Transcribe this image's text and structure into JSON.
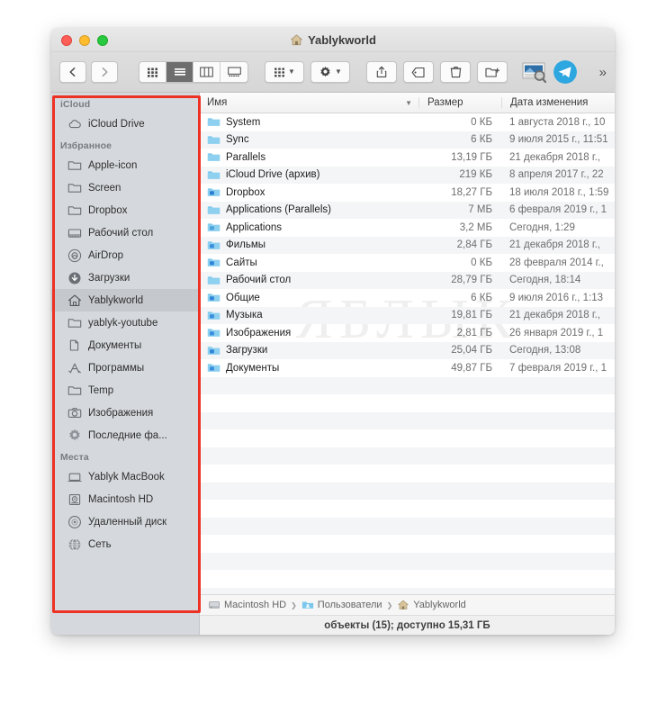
{
  "window": {
    "title": "Yablykworld",
    "title_icon": "home-icon",
    "traffic_lights": [
      "close",
      "minimize",
      "zoom"
    ]
  },
  "toolbar": {
    "back_label": "‹",
    "forward_label": "›",
    "view_modes": [
      {
        "name": "icon-view",
        "active": false
      },
      {
        "name": "list-view",
        "active": true
      },
      {
        "name": "column-view",
        "active": false
      },
      {
        "name": "gallery-view",
        "active": false
      }
    ],
    "arrange_label": "arrange-icon",
    "action_label": "gear-icon",
    "share_label": "share-icon",
    "tag_label": "tag-icon",
    "delete_label": "trash-icon",
    "new_folder_label": "new-folder-icon",
    "preview_app_label": "preview-app-icon",
    "telegram_label": "telegram-icon",
    "overflow_label": "»",
    "telegram_color": "#2ea6e0"
  },
  "sidebar": {
    "sections": [
      {
        "header": "iCloud",
        "items": [
          {
            "label": "iCloud Drive",
            "icon": "cloud-icon",
            "selected": false
          }
        ]
      },
      {
        "header": "Избранное",
        "items": [
          {
            "label": "Apple-icon",
            "icon": "folder-icon",
            "selected": false
          },
          {
            "label": "Screen",
            "icon": "folder-icon",
            "selected": false
          },
          {
            "label": "Dropbox",
            "icon": "folder-icon",
            "selected": false
          },
          {
            "label": "Рабочий стол",
            "icon": "desktop-icon",
            "selected": false
          },
          {
            "label": "AirDrop",
            "icon": "airdrop-icon",
            "selected": false
          },
          {
            "label": "Загрузки",
            "icon": "downloads-icon",
            "selected": false
          },
          {
            "label": "Yablykworld",
            "icon": "home-icon",
            "selected": true
          },
          {
            "label": "yablyk-youtube",
            "icon": "folder-icon",
            "selected": false
          },
          {
            "label": "Документы",
            "icon": "documents-icon",
            "selected": false
          },
          {
            "label": "Программы",
            "icon": "applications-icon",
            "selected": false
          },
          {
            "label": "Temp",
            "icon": "folder-icon",
            "selected": false
          },
          {
            "label": "Изображения",
            "icon": "camera-icon",
            "selected": false
          },
          {
            "label": "Последние фа...",
            "icon": "gear-icon",
            "selected": false
          }
        ]
      },
      {
        "header": "Места",
        "items": [
          {
            "label": "Yablyk MacBook",
            "icon": "laptop-icon",
            "selected": false
          },
          {
            "label": "Macintosh HD",
            "icon": "harddisk-icon",
            "selected": false
          },
          {
            "label": "Удаленный диск",
            "icon": "optical-disc-icon",
            "selected": false
          },
          {
            "label": "Сеть",
            "icon": "network-globe-icon",
            "selected": false
          }
        ]
      }
    ]
  },
  "file_list": {
    "columns": {
      "name": "Имя",
      "size": "Размер",
      "date": "Дата изменения"
    },
    "sort_indicator": "∨",
    "watermark": "ЯБЛЫК",
    "rows": [
      {
        "name": "System",
        "size": "0 КБ",
        "date": "1 августа 2018 г., 10",
        "icon": "folder-icon"
      },
      {
        "name": "Sync",
        "size": "6 КБ",
        "date": "9 июля 2015 г., 11:51",
        "icon": "folder-icon"
      },
      {
        "name": "Parallels",
        "size": "13,19 ГБ",
        "date": "21 декабря 2018 г.,",
        "icon": "folder-icon"
      },
      {
        "name": "iCloud Drive (архив)",
        "size": "219 КБ",
        "date": "8 апреля 2017 г., 22",
        "icon": "folder-icon"
      },
      {
        "name": "Dropbox",
        "size": "18,27 ГБ",
        "date": "18 июля 2018 г., 1:59",
        "icon": "dropbox-folder-icon"
      },
      {
        "name": "Applications (Parallels)",
        "size": "7 МБ",
        "date": "6 февраля 2019 г., 1",
        "icon": "folder-icon"
      },
      {
        "name": "Applications",
        "size": "3,2 МБ",
        "date": "Сегодня, 1:29",
        "icon": "applications-folder-icon"
      },
      {
        "name": "Фильмы",
        "size": "2,84 ГБ",
        "date": "21 декабря 2018 г.,",
        "icon": "movies-folder-icon"
      },
      {
        "name": "Сайты",
        "size": "0 КБ",
        "date": "28 февраля 2014 г.,",
        "icon": "sites-folder-icon"
      },
      {
        "name": "Рабочий стол",
        "size": "28,79 ГБ",
        "date": "Сегодня, 18:14",
        "icon": "desktop-folder-icon"
      },
      {
        "name": "Общие",
        "size": "6 КБ",
        "date": "9 июля 2016 г., 1:13",
        "icon": "public-folder-icon"
      },
      {
        "name": "Музыка",
        "size": "19,81 ГБ",
        "date": "21 декабря 2018 г.,",
        "icon": "music-folder-icon"
      },
      {
        "name": "Изображения",
        "size": "2,81 ГБ",
        "date": "26 января 2019 г., 1",
        "icon": "pictures-folder-icon"
      },
      {
        "name": "Загрузки",
        "size": "25,04 ГБ",
        "date": "Сегодня, 13:08",
        "icon": "downloads-folder-icon"
      },
      {
        "name": "Документы",
        "size": "49,87 ГБ",
        "date": "7 февраля 2019 г., 1",
        "icon": "documents-folder-icon"
      }
    ]
  },
  "path_bar": {
    "items": [
      {
        "label": "Macintosh HD",
        "icon": "harddisk-icon"
      },
      {
        "label": "Пользователи",
        "icon": "users-folder-icon"
      },
      {
        "label": "Yablykworld",
        "icon": "home-icon"
      }
    ],
    "separator": "›"
  },
  "status_bar": {
    "text": "объекты (15); доступно 15,31 ГБ"
  },
  "annotation": {
    "color": "#ed3124",
    "target": "sidebar"
  }
}
